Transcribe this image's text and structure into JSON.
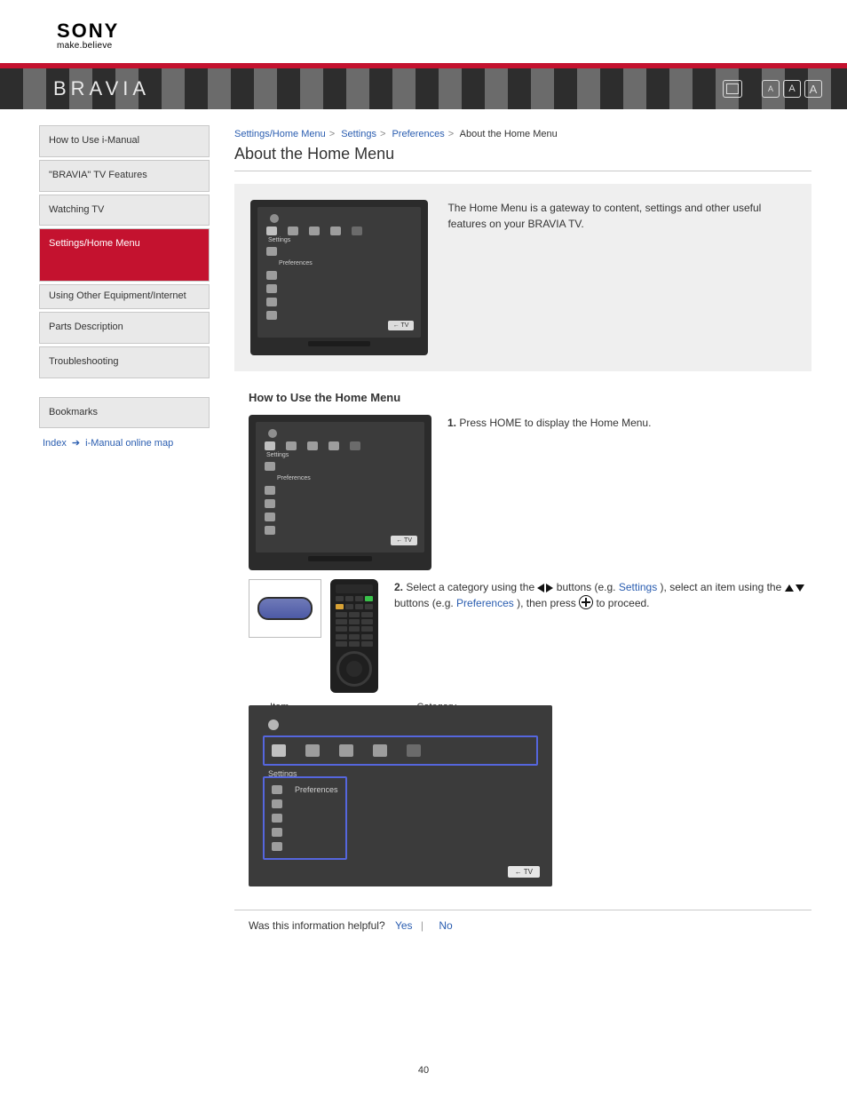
{
  "brand": {
    "name": "SONY",
    "tagline": "make.believe",
    "product": "BRAVIA"
  },
  "fontSizers": {
    "s": "A",
    "m": "A",
    "l": "A"
  },
  "nav": {
    "items": [
      {
        "label": "How to Use i-Manual"
      },
      {
        "label": "\"BRAVIA\" TV Features"
      },
      {
        "label": "Watching TV"
      },
      {
        "label": "Settings/Home Menu"
      },
      {
        "label": "Using Other Equipment/Internet"
      },
      {
        "label": "Parts Description"
      },
      {
        "label": "Troubleshooting"
      }
    ],
    "activeIndex": 3,
    "bookmarks": {
      "label": "Bookmarks"
    },
    "trail": {
      "label": "Index",
      "to": "i-Manual online map"
    }
  },
  "breadcrumb": {
    "a": "Settings/Home Menu",
    "b": "Settings",
    "c": "Preferences",
    "here": "About the Home Menu"
  },
  "page": {
    "title": "About the Home Menu",
    "number": "40"
  },
  "intro": {
    "text": "The Home Menu is a gateway to content, settings and other useful features on your BRAVIA TV.",
    "tvBadge": "← TV"
  },
  "howto": {
    "heading": "How to Use the Home Menu",
    "steps": {
      "one": {
        "num": "1.",
        "text": "Press HOME to display the Home Menu."
      },
      "two": {
        "num": "2.",
        "line1_a": "Select a category using the ",
        "line1_b": " buttons (e.g. ",
        "line1_link": "Settings",
        "line1_c": "), select an item using the ",
        "line1_d": " buttons (e.g. ",
        "line1_link2": "Preferences",
        "line1_e": "), then press ",
        "line1_f": " to proceed."
      }
    },
    "callouts": {
      "a": "Item",
      "b": "Category"
    },
    "menu": {
      "settingsLabel": "Settings",
      "prefLabel": "Preferences",
      "badge": "← TV"
    }
  },
  "helpful": {
    "q": "Was this information helpful?",
    "yes": "Yes",
    "no": "No"
  }
}
